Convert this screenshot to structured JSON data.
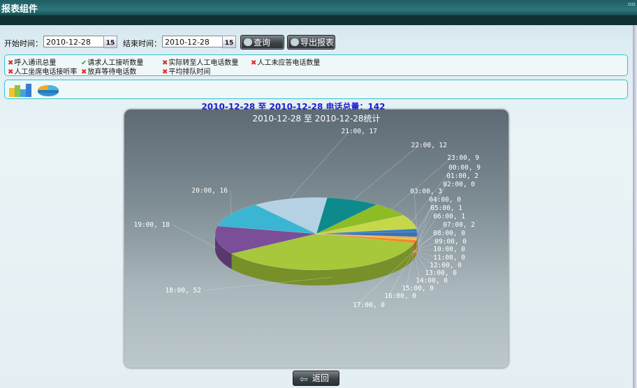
{
  "window": {
    "title": "报表组件"
  },
  "filters": {
    "start_label": "开始时间：",
    "start_value": "2010-12-28",
    "end_label": "结束时间：",
    "end_value": "2010-12-28",
    "calendar_day": "15",
    "query_label": "查询",
    "export_label": "导出报表"
  },
  "legend": [
    {
      "label": "呼入通讯总量",
      "state": "x"
    },
    {
      "label": "请求人工接听数量",
      "state": "check"
    },
    {
      "label": "实际转至人工电话数量",
      "state": "x"
    },
    {
      "label": "人工未应答电话数量",
      "state": "x"
    },
    {
      "label": "人工坐席电话接听率",
      "state": "x"
    },
    {
      "label": "放弃等待电话数",
      "state": "x"
    },
    {
      "label": "平均排队时间",
      "state": "x"
    }
  ],
  "toolbar": {
    "bar_icon": "bar-chart-icon",
    "pie_icon": "pie-chart-icon"
  },
  "summary_title": "2010-12-28 至 2010-12-28 电话总量：142",
  "chart_data": {
    "type": "pie",
    "title": "2010-12-28 至 2010-12-28统计",
    "slices": [
      {
        "label": "18:00, 52",
        "value": 52,
        "color": "#a6c83a"
      },
      {
        "label": "19:00, 18",
        "value": 18,
        "color": "#7a4f98"
      },
      {
        "label": "20:00, 16",
        "value": 16,
        "color": "#3ab6d2"
      },
      {
        "label": "21:00, 17",
        "value": 17,
        "color": "#b5d2e4"
      },
      {
        "label": "22:00, 12",
        "value": 12,
        "color": "#0f8a8c"
      },
      {
        "label": "23:00, 9",
        "value": 9,
        "color": "#8ebc24"
      },
      {
        "label": "00:00, 9",
        "value": 9,
        "color": "#c6d84a"
      },
      {
        "label": "01:00, 2",
        "value": 2,
        "color": "#3a7bc0"
      },
      {
        "label": "02:00, 0",
        "value": 0,
        "color": "#e08a2a"
      },
      {
        "label": "03:00, 3",
        "value": 3,
        "color": "#3b6fb8"
      },
      {
        "label": "04:00, 0",
        "value": 0,
        "color": "#e06a2a"
      },
      {
        "label": "05:00, 1",
        "value": 1,
        "color": "#e6a53a"
      },
      {
        "label": "06:00, 1",
        "value": 1,
        "color": "#f0c040"
      },
      {
        "label": "07:00, 2",
        "value": 2,
        "color": "#f08a2a"
      },
      {
        "label": "08:00, 0",
        "value": 0,
        "color": "#40a0d0"
      },
      {
        "label": "09:00, 0",
        "value": 0,
        "color": "#2f7fc0"
      },
      {
        "label": "10:00, 0",
        "value": 0,
        "color": "#2f6fb0"
      },
      {
        "label": "11:00, 0",
        "value": 0,
        "color": "#70b8d8"
      },
      {
        "label": "12:00, 0",
        "value": 0,
        "color": "#5aa8c8"
      },
      {
        "label": "13:00, 0",
        "value": 0,
        "color": "#4a98b8"
      },
      {
        "label": "14:00, 0",
        "value": 0,
        "color": "#3a88a8"
      },
      {
        "label": "15:00, 0",
        "value": 0,
        "color": "#2a7898"
      },
      {
        "label": "16:00, 0",
        "value": 0,
        "color": "#1a6888"
      },
      {
        "label": "17:00, 0",
        "value": 0,
        "color": "#0a5878"
      }
    ]
  },
  "back_label": "返回"
}
